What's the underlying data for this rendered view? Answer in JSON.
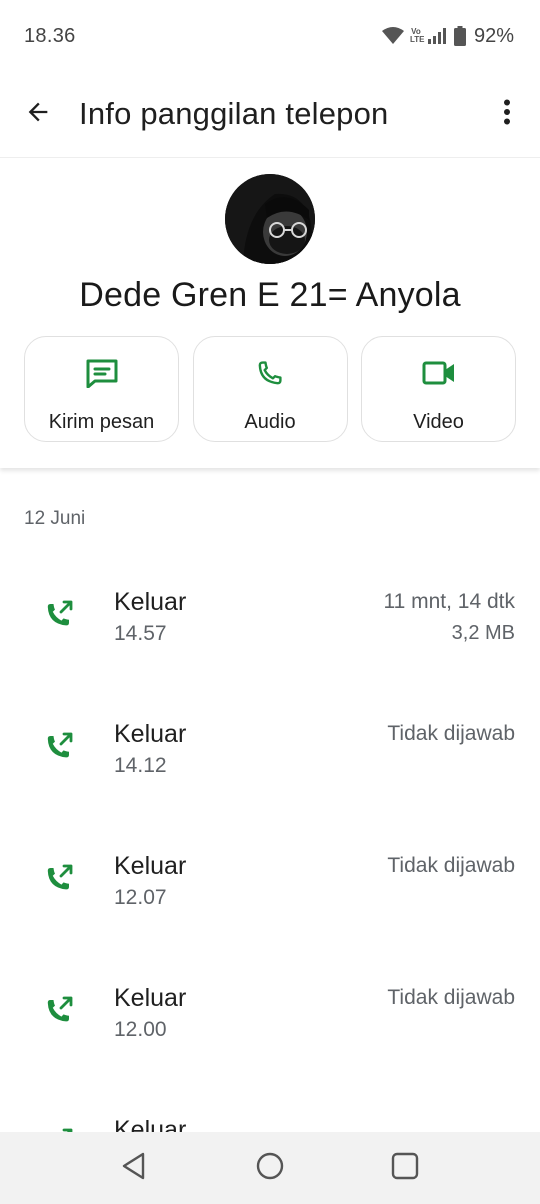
{
  "status_bar": {
    "time": "18.36",
    "battery_percent": "92%",
    "volte_top": "Vo",
    "volte_bottom": "LTE",
    "icons": [
      "wifi-icon",
      "volte-icon",
      "signal-icon",
      "battery-icon"
    ]
  },
  "app_bar": {
    "title": "Info panggilan telepon",
    "back_icon": "arrow-back-icon",
    "more_icon": "more-vert-icon"
  },
  "contact": {
    "name": "Dede Gren E 21= Anyola"
  },
  "actions": [
    {
      "label": "Kirim pesan",
      "icon": "message-icon"
    },
    {
      "label": "Audio",
      "icon": "phone-icon"
    },
    {
      "label": "Video",
      "icon": "videocam-icon"
    }
  ],
  "calls": {
    "date": "12 Juni",
    "items": [
      {
        "type": "Keluar",
        "time": "14.57",
        "status": "11 mnt, 14 dtk",
        "size": "3,2 MB"
      },
      {
        "type": "Keluar",
        "time": "14.12",
        "status": "Tidak dijawab",
        "size": ""
      },
      {
        "type": "Keluar",
        "time": "12.07",
        "status": "Tidak dijawab",
        "size": ""
      },
      {
        "type": "Keluar",
        "time": "12.00",
        "status": "Tidak dijawab",
        "size": ""
      },
      {
        "type": "Keluar",
        "time": "",
        "status": "",
        "size": ""
      }
    ]
  },
  "colors": {
    "accent_green": "#1e8e3e",
    "text_primary": "#1f1f1f",
    "text_secondary": "#5f6368"
  },
  "nav_bar": {
    "buttons": [
      "back-triangle-icon",
      "home-circle-icon",
      "recents-square-icon"
    ]
  }
}
